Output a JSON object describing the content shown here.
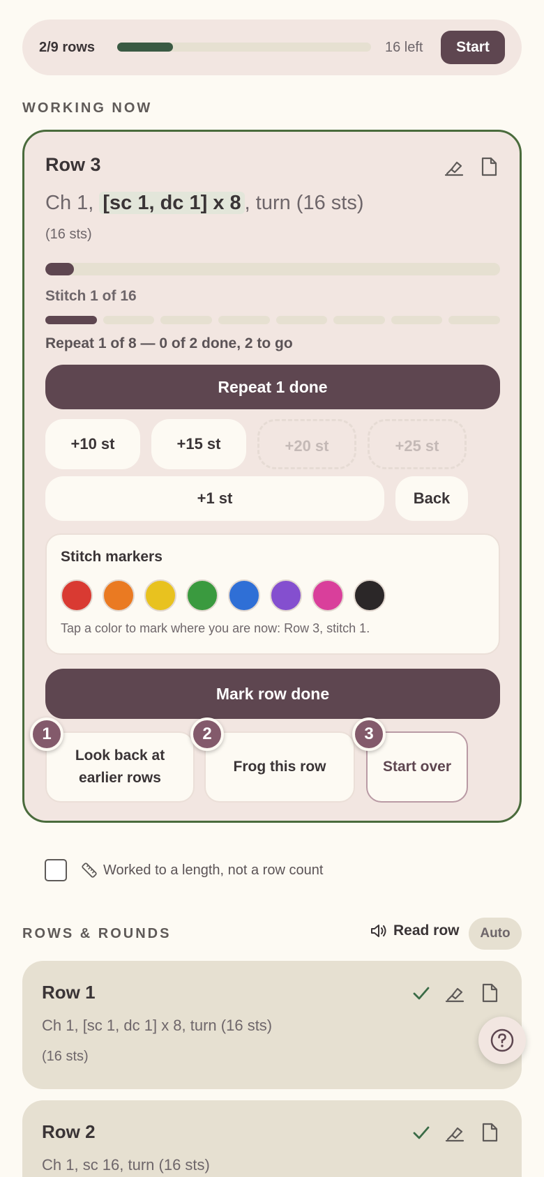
{
  "topbar": {
    "rows_progress": "2/9 rows",
    "rows_fraction": 0.22,
    "remaining": "16 left",
    "start_label": "Start"
  },
  "working_now": {
    "section_title": "WORKING NOW",
    "row_title": "Row 3",
    "instruction_prefix": "Ch 1, ",
    "instruction_highlight": "[sc 1, dc 1] x 8",
    "instruction_suffix": ", turn (16 sts)",
    "stitch_count": "(16 sts)",
    "stitch_fraction": 0.0625,
    "stitch_label": "Stitch 1 of 16",
    "repeat_segments_done": 1,
    "repeat_segments_total": 8,
    "repeat_label": "Repeat 1 of 8 — 0 of 2 done, 2 to go",
    "repeat_button": "Repeat 1 done",
    "increments": [
      {
        "label": "+10 st",
        "enabled": true
      },
      {
        "label": "+15 st",
        "enabled": true
      },
      {
        "label": "+20 st",
        "enabled": false
      },
      {
        "label": "+25 st",
        "enabled": false
      }
    ],
    "plus_one": "+1 st",
    "back": "Back",
    "markers": {
      "title": "Stitch markers",
      "colors": [
        "#d93a32",
        "#ea7a22",
        "#e8c21f",
        "#3a9a3f",
        "#2f6fd6",
        "#844fcf",
        "#d93f9b",
        "#2b2728"
      ],
      "hint": "Tap a color to mark where you are now: Row 3, stitch 1."
    },
    "mark_done": "Mark row done",
    "actions": [
      {
        "badge": "1",
        "label": "Look back at earlier rows"
      },
      {
        "badge": "2",
        "label": "Frog this row"
      },
      {
        "badge": "3",
        "label": "Start over"
      }
    ]
  },
  "length_option": {
    "checked": false,
    "label": "Worked to a length, not a row count"
  },
  "rows_rounds": {
    "section_title": "ROWS & ROUNDS",
    "read_row": "Read row",
    "auto": "Auto",
    "rows": [
      {
        "title": "Row 1",
        "instruction": "Ch 1, [sc 1, dc 1] x 8, turn (16 sts)",
        "sts": "(16 sts)",
        "done": true
      },
      {
        "title": "Row 2",
        "instruction": "Ch 1, sc 16, turn (16 sts)",
        "sts": "",
        "done": true
      }
    ]
  },
  "icons": {
    "edit": "highlighter-icon",
    "note": "note-icon",
    "check": "check-icon",
    "speaker": "speaker-icon",
    "ruler": "ruler-icon",
    "help": "help-icon"
  }
}
